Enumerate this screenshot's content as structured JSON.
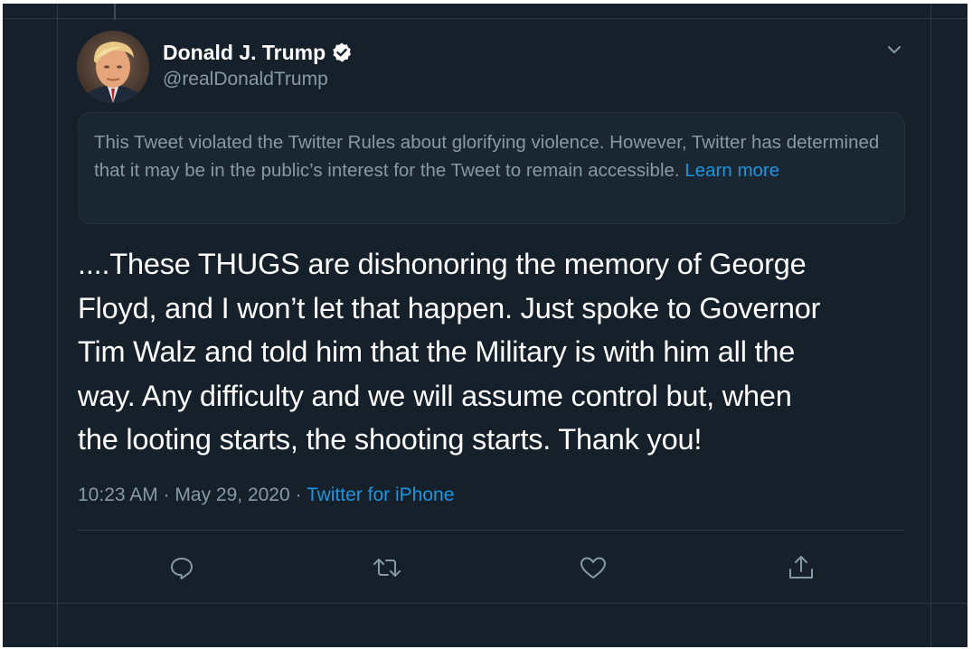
{
  "tweet": {
    "author": {
      "display_name": "Donald J. Trump",
      "handle": "@realDonaldTrump",
      "verified": true,
      "avatar_icon": "profile-photo"
    },
    "notice": {
      "text": "This Tweet violated the Twitter Rules about glorifying violence. However, Twitter has determined that it may be in the public’s interest for the Tweet to remain accessible.",
      "link_label": "Learn more"
    },
    "body_lines": [
      "....These THUGS are dishonoring the memory of George",
      "Floyd, and I won’t let that happen. Just spoke to Governor",
      "Tim Walz and told him that the Military is with him all the",
      "way. Any difficulty and we will assume control but, when",
      "the looting starts, the shooting starts. Thank you!"
    ],
    "meta": {
      "time": "10:23 AM",
      "separator": " · ",
      "date": "May 29, 2020",
      "source": "Twitter for iPhone"
    },
    "actions": [
      "reply-icon",
      "retweet-icon",
      "like-icon",
      "share-icon"
    ]
  },
  "colors": {
    "background": "#15202b",
    "notice_background": "#1a2631",
    "primary_text": "#ffffff",
    "secondary_text": "#8899a6",
    "link": "#1b95e0",
    "border": "#2c3844"
  }
}
